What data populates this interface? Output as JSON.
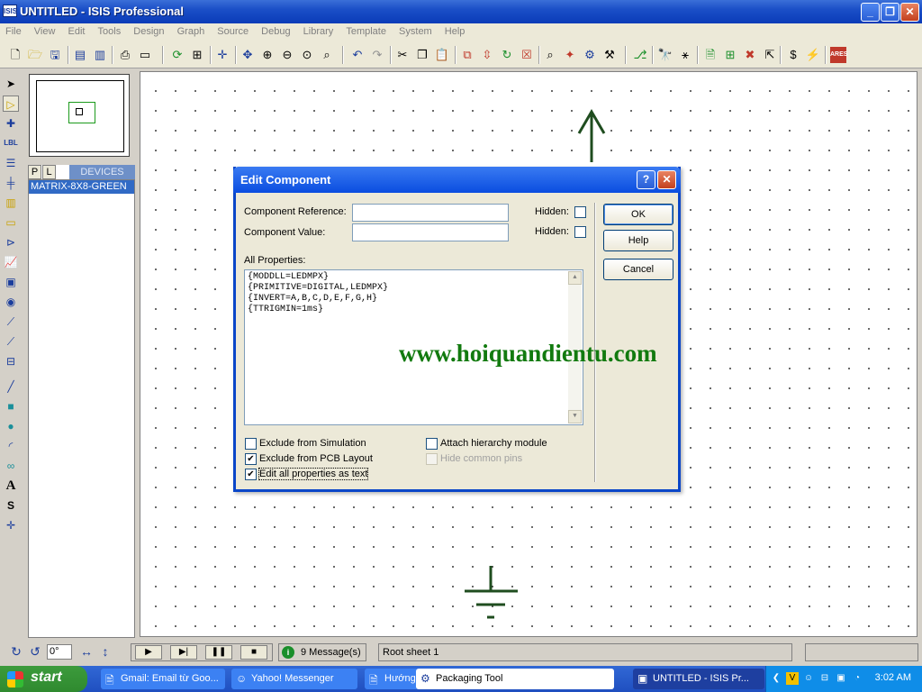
{
  "window": {
    "app_icon": "ISIS",
    "title": "UNTITLED - ISIS Professional"
  },
  "menu": [
    "File",
    "View",
    "Edit",
    "Tools",
    "Design",
    "Graph",
    "Source",
    "Debug",
    "Library",
    "Template",
    "System",
    "Help"
  ],
  "toolbar_icons": [
    "new-file-icon",
    "open-folder-icon",
    "save-icon",
    "import-icon",
    "export-icon",
    "print-icon",
    "print-area-icon",
    "refresh-icon",
    "grid-icon",
    "origin-icon",
    "pan-icon",
    "zoom-in-icon",
    "zoom-out-icon",
    "zoom-all-icon",
    "zoom-area-icon",
    "undo-icon",
    "redo-icon",
    "cut-icon",
    "copy-icon",
    "paste-icon",
    "block-copy-icon",
    "block-move-icon",
    "block-rotate-icon",
    "block-delete-icon",
    "pick-device-icon",
    "make-device-icon",
    "packaging-tool-icon",
    "decompose-icon",
    "wire-autorouter-icon",
    "search-tag-icon",
    "property-tool-icon",
    "new-sheet-icon",
    "add-sheet-icon",
    "remove-sheet-icon",
    "exit-to-parent-icon",
    "bill-of-materials-icon",
    "electrical-rules-icon",
    "netlist-to-ares-icon"
  ],
  "palette_icons": [
    "selection-mode-icon",
    "component-mode-icon",
    "junction-dot-icon",
    "wire-label-icon",
    "text-script-icon",
    "bus-icon",
    "subcircuit-icon",
    "terminal-icon",
    "device-pin-icon",
    "graph-icon",
    "tape-recorder-icon",
    "generator-icon",
    "voltage-probe-icon",
    "current-probe-icon",
    "virtual-instrument-icon",
    "line-icon",
    "box-icon",
    "circle-icon",
    "arc-icon",
    "path-icon",
    "text-icon",
    "symbol-icon",
    "marker-icon"
  ],
  "device_panel": {
    "tab_p": "P",
    "tab_l": "L",
    "header": "DEVICES",
    "items": [
      "MATRIX-8X8-GREEN"
    ]
  },
  "dialog": {
    "title": "Edit Component",
    "help_glyph": "?",
    "close_glyph": "✕",
    "component_reference_label": "Component Reference:",
    "component_reference_value": "",
    "component_value_label": "Component Value:",
    "component_value_value": "",
    "hidden_label": "Hidden:",
    "all_properties_label": "All Properties:",
    "properties": [
      "{MODDLL=LEDMPX}",
      "{PRIMITIVE=DIGITAL,LEDMPX}",
      "{INVERT=A,B,C,D,E,F,G,H}",
      "{TTRIGMIN=1ms}"
    ],
    "ok_label": "OK",
    "help_label": "Help",
    "cancel_label": "Cancel",
    "options": {
      "exclude_simulation": {
        "label": "Exclude from Simulation",
        "checked": false
      },
      "exclude_pcb": {
        "label": "Exclude from PCB Layout",
        "checked": true
      },
      "edit_as_text": {
        "label": "Edit all properties as text",
        "checked": true
      },
      "attach_hierarchy": {
        "label": "Attach hierarchy module",
        "checked": false
      },
      "hide_common_pins": {
        "label": "Hide common pins",
        "checked": false,
        "disabled": true
      }
    }
  },
  "watermark": "www.hoiquandientu.com",
  "statusbar": {
    "angle": "0°",
    "messages": "9 Message(s)",
    "sheet": "Root sheet 1"
  },
  "taskbar": {
    "start": "start",
    "tasks": [
      "Gmail: Email từ Goo...",
      "Yahoo! Messenger",
      "Hướng",
      "Packaging Tool",
      "UNTITLED - ISIS Pr..."
    ],
    "clock": "3:02 AM"
  }
}
